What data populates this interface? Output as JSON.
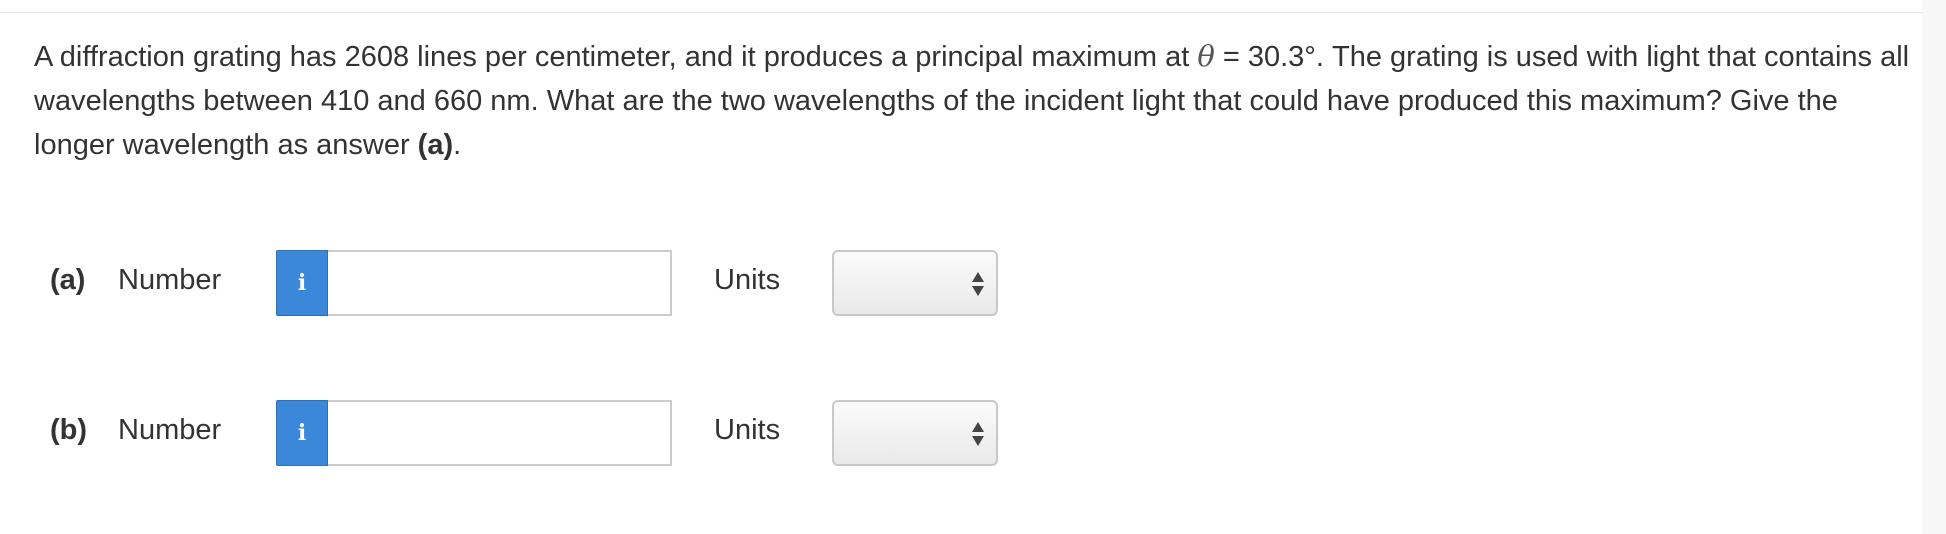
{
  "question": {
    "part1": "A diffraction grating has 2608 lines per centimeter, and it produces a principal maximum at ",
    "theta_symbol": "θ",
    "part2": " = 30.3°. The grating is used with light that contains all wavelengths between 410 and 660 nm. What are the two wavelengths of the incident light that could have produced this maximum? Give the longer wavelength as answer ",
    "part3_bold": "(a)",
    "part4": "."
  },
  "answers": [
    {
      "part_label": "(a)",
      "number_label": "Number",
      "info_icon": "info-icon",
      "info_glyph": "i",
      "number_value": "",
      "units_label": "Units",
      "units_value": ""
    },
    {
      "part_label": "(b)",
      "number_label": "Number",
      "info_icon": "info-icon",
      "info_glyph": "i",
      "number_value": "",
      "units_label": "Units",
      "units_value": ""
    }
  ],
  "colors": {
    "info_button": "#3b87d9",
    "text": "#333333",
    "input_border": "#cccccc"
  }
}
